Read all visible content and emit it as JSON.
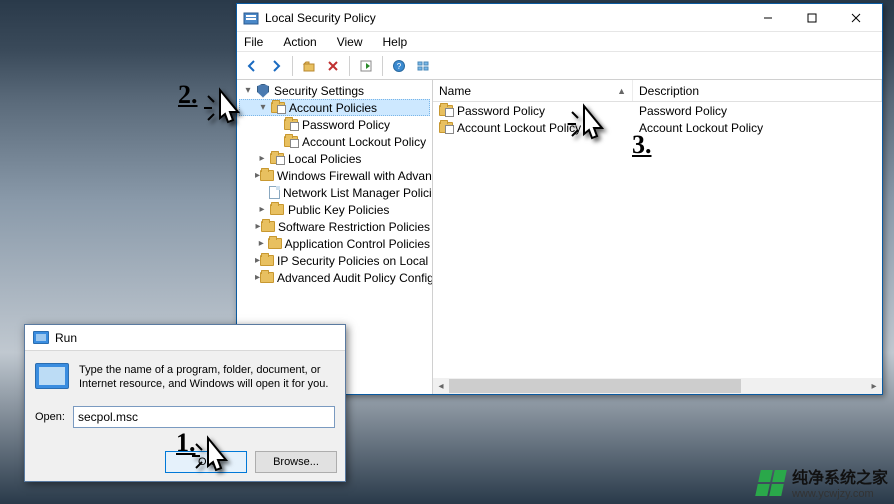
{
  "lsp": {
    "title": "Local Security Policy",
    "menu": {
      "file": "File",
      "action": "Action",
      "view": "View",
      "help": "Help"
    },
    "tree": {
      "root": "Security Settings",
      "items": [
        {
          "label": "Account Policies",
          "selected": true
        },
        {
          "label": "Password Policy"
        },
        {
          "label": "Account Lockout Policy"
        },
        {
          "label": "Local Policies"
        },
        {
          "label": "Windows Firewall with Advanced Sec"
        },
        {
          "label": "Network List Manager Policies"
        },
        {
          "label": "Public Key Policies"
        },
        {
          "label": "Software Restriction Policies"
        },
        {
          "label": "Application Control Policies"
        },
        {
          "label": "IP Security Policies on Local Compute"
        },
        {
          "label": "Advanced Audit Policy Configuration"
        }
      ]
    },
    "list": {
      "columns": {
        "name": "Name",
        "desc": "Description"
      },
      "rows": [
        {
          "name": "Password Policy",
          "desc": "Password Policy"
        },
        {
          "name": "Account Lockout Policy",
          "desc": "Account Lockout Policy"
        }
      ]
    }
  },
  "run": {
    "title": "Run",
    "description": "Type the name of a program, folder, document, or Internet resource, and Windows will open it for you.",
    "open_label": "Open:",
    "open_value": "secpol.msc",
    "ok": "OK",
    "browse": "Browse..."
  },
  "annotations": {
    "n1": "1.",
    "n2": "2.",
    "n3": "3."
  },
  "watermark": {
    "cn": "纯净系统之家",
    "url": "www.ycwjzy.com"
  }
}
